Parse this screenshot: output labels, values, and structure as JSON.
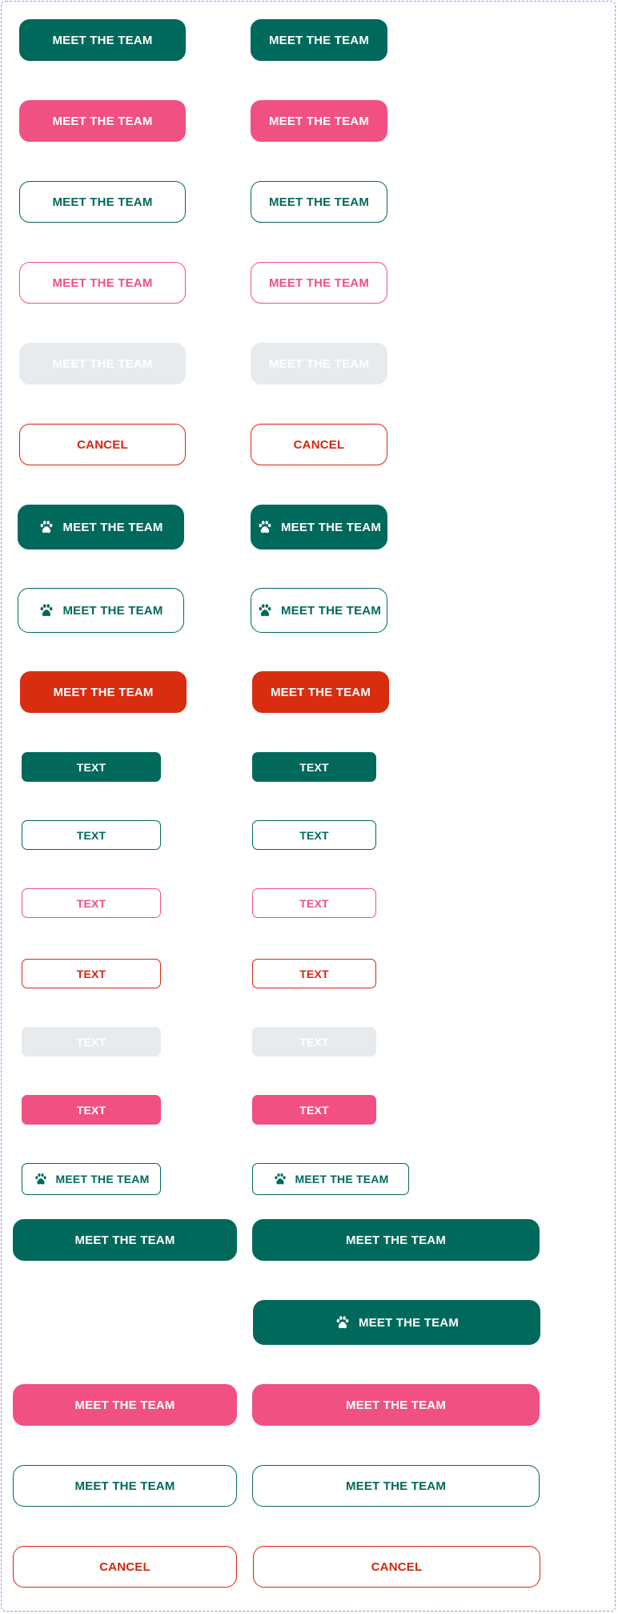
{
  "labels": {
    "meet_team": "MEET THE TEAM",
    "cancel": "CANCEL",
    "text": "TEXT"
  },
  "icons": {
    "paw": "paw-icon"
  },
  "colors": {
    "teal": "#00695c",
    "pink": "#f05182",
    "red": "#d92d10",
    "red_outline": "#d7260f",
    "disabled": "#e8ebee",
    "frame_border": "#a78bfa"
  }
}
